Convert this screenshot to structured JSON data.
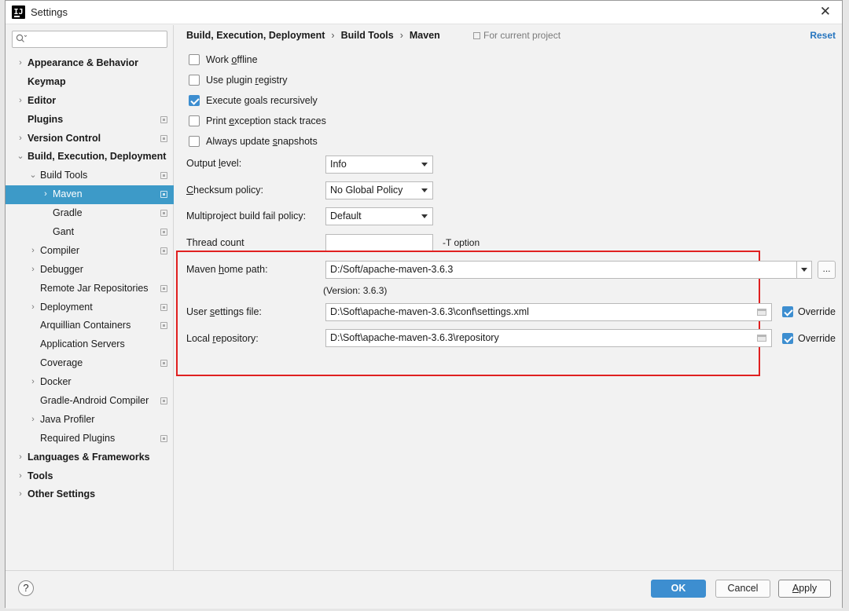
{
  "window": {
    "title": "Settings",
    "close_glyph": "✕"
  },
  "search": {
    "value": "",
    "placeholder": ""
  },
  "sidebar": {
    "items": [
      {
        "label": "Appearance & Behavior",
        "bold": true,
        "level": 0,
        "arrow": "›",
        "project": false,
        "selected": false
      },
      {
        "label": "Keymap",
        "bold": true,
        "level": 0,
        "arrow": "",
        "project": false,
        "selected": false
      },
      {
        "label": "Editor",
        "bold": true,
        "level": 0,
        "arrow": "›",
        "project": false,
        "selected": false
      },
      {
        "label": "Plugins",
        "bold": true,
        "level": 0,
        "arrow": "",
        "project": true,
        "selected": false
      },
      {
        "label": "Version Control",
        "bold": true,
        "level": 0,
        "arrow": "›",
        "project": true,
        "selected": false
      },
      {
        "label": "Build, Execution, Deployment",
        "bold": true,
        "level": 0,
        "arrow": "⌄",
        "project": false,
        "selected": false
      },
      {
        "label": "Build Tools",
        "bold": false,
        "level": 1,
        "arrow": "⌄",
        "project": true,
        "selected": false
      },
      {
        "label": "Maven",
        "bold": false,
        "level": 2,
        "arrow": "›",
        "project": true,
        "selected": true
      },
      {
        "label": "Gradle",
        "bold": false,
        "level": 2,
        "arrow": "",
        "project": true,
        "selected": false
      },
      {
        "label": "Gant",
        "bold": false,
        "level": 2,
        "arrow": "",
        "project": true,
        "selected": false
      },
      {
        "label": "Compiler",
        "bold": false,
        "level": 1,
        "arrow": "›",
        "project": true,
        "selected": false
      },
      {
        "label": "Debugger",
        "bold": false,
        "level": 1,
        "arrow": "›",
        "project": false,
        "selected": false
      },
      {
        "label": "Remote Jar Repositories",
        "bold": false,
        "level": 1,
        "arrow": "",
        "project": true,
        "selected": false
      },
      {
        "label": "Deployment",
        "bold": false,
        "level": 1,
        "arrow": "›",
        "project": true,
        "selected": false
      },
      {
        "label": "Arquillian Containers",
        "bold": false,
        "level": 1,
        "arrow": "",
        "project": true,
        "selected": false
      },
      {
        "label": "Application Servers",
        "bold": false,
        "level": 1,
        "arrow": "",
        "project": false,
        "selected": false
      },
      {
        "label": "Coverage",
        "bold": false,
        "level": 1,
        "arrow": "",
        "project": true,
        "selected": false
      },
      {
        "label": "Docker",
        "bold": false,
        "level": 1,
        "arrow": "›",
        "project": false,
        "selected": false
      },
      {
        "label": "Gradle-Android Compiler",
        "bold": false,
        "level": 1,
        "arrow": "",
        "project": true,
        "selected": false
      },
      {
        "label": "Java Profiler",
        "bold": false,
        "level": 1,
        "arrow": "›",
        "project": false,
        "selected": false
      },
      {
        "label": "Required Plugins",
        "bold": false,
        "level": 1,
        "arrow": "",
        "project": true,
        "selected": false
      },
      {
        "label": "Languages & Frameworks",
        "bold": true,
        "level": 0,
        "arrow": "›",
        "project": false,
        "selected": false
      },
      {
        "label": "Tools",
        "bold": true,
        "level": 0,
        "arrow": "›",
        "project": false,
        "selected": false
      },
      {
        "label": "Other Settings",
        "bold": true,
        "level": 0,
        "arrow": "›",
        "project": false,
        "selected": false
      }
    ]
  },
  "breadcrumb": {
    "parts": [
      "Build, Execution, Deployment",
      "Build Tools",
      "Maven"
    ],
    "separator": "›",
    "scope": "For current project",
    "reset": "Reset"
  },
  "checkboxes": [
    {
      "pre": "Work ",
      "mn": "o",
      "post": "ffline",
      "checked": false
    },
    {
      "pre": "Use plugin ",
      "mn": "r",
      "post": "egistry",
      "checked": false
    },
    {
      "pre": "Execute ",
      "mn": "g",
      "post": "oals recursively",
      "checked": true
    },
    {
      "pre": "Print ",
      "mn": "e",
      "post": "xception stack traces",
      "checked": false
    },
    {
      "pre": "Always update ",
      "mn": "s",
      "post": "napshots",
      "checked": false
    }
  ],
  "output_level": {
    "pre": "Output ",
    "mn": "l",
    "post": "evel:",
    "value": "Info"
  },
  "checksum_policy": {
    "pre": "",
    "mn": "C",
    "post": "hecksum policy:",
    "value": "No Global Policy"
  },
  "multiproject": {
    "label": "Multiproject build fail policy:",
    "value": "Default"
  },
  "thread_count": {
    "label": "Thread count",
    "value": "",
    "hint": "-T option"
  },
  "maven_home": {
    "pre": "Maven ",
    "mn": "h",
    "post": "ome path:",
    "value": "D:/Soft/apache-maven-3.6.3",
    "version": "(Version: 3.6.3)",
    "dots": "..."
  },
  "user_settings": {
    "pre": "User ",
    "mn": "s",
    "post": "ettings file:",
    "value": "D:\\Soft\\apache-maven-3.6.3\\conf\\settings.xml",
    "override": "Override",
    "override_checked": true
  },
  "local_repo": {
    "pre": "Local ",
    "mn": "r",
    "post": "epository:",
    "value": "D:\\Soft\\apache-maven-3.6.3\\repository",
    "override": "Override",
    "override_checked": true
  },
  "footer": {
    "help": "?",
    "ok": "OK",
    "cancel": "Cancel",
    "apply_mn": "A",
    "apply_rest": "pply"
  },
  "colors": {
    "accent": "#3d8ed0",
    "selection": "#3d9ac8",
    "highlight_box": "#e02020",
    "link": "#2675bf"
  }
}
